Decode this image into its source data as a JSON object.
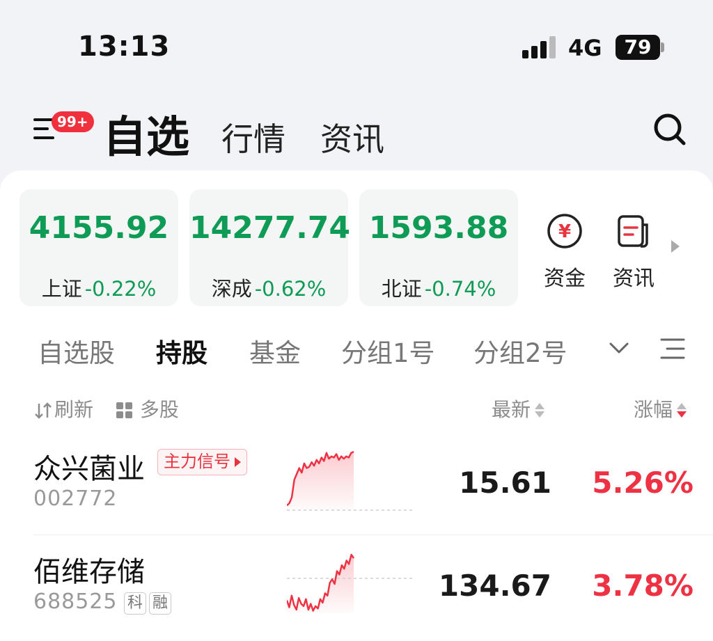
{
  "status_bar": {
    "time": "13:13",
    "network": "4G",
    "battery": "79"
  },
  "header": {
    "badge": "99+",
    "tabs": [
      {
        "label": "自选"
      },
      {
        "label": "行情"
      },
      {
        "label": "资讯"
      }
    ]
  },
  "indices": [
    {
      "value": "4155.92",
      "name": "上证",
      "change": "-0.22%"
    },
    {
      "value": "14277.74",
      "name": "深成",
      "change": "-0.62%"
    },
    {
      "value": "1593.88",
      "name": "北证",
      "change": "-0.74%"
    }
  ],
  "quick_links": [
    {
      "label": "资金",
      "icon": "yuan-circle-icon",
      "color": "#e8343f"
    },
    {
      "label": "资讯",
      "icon": "news-doc-icon",
      "color": "#e8343f"
    }
  ],
  "group_tabs": [
    {
      "label": "自选股"
    },
    {
      "label": "持股"
    },
    {
      "label": "基金"
    },
    {
      "label": "分组1号"
    },
    {
      "label": "分组2号"
    }
  ],
  "list_header": {
    "refresh": "刷新",
    "multi": "多股",
    "latest": "最新",
    "change": "涨幅"
  },
  "stocks": [
    {
      "name": "众兴菌业",
      "code": "002772",
      "tag": "主力信号",
      "price": "15.61",
      "change": "5.26%",
      "spark": [
        0.08,
        0.12,
        0.22,
        0.52,
        0.62,
        0.72,
        0.64,
        0.8,
        0.72,
        0.74,
        0.82,
        0.76,
        0.86,
        0.8,
        0.9,
        0.84,
        0.98,
        0.88,
        0.92,
        0.9,
        0.96,
        0.86,
        0.92,
        0.88,
        0.92,
        0.9,
        0.98,
        1.0
      ]
    },
    {
      "name": "佰维存储",
      "code": "688525",
      "badges": [
        "科",
        "融"
      ],
      "price": "134.67",
      "change": "3.78%",
      "spark": [
        0.22,
        0.1,
        0.3,
        0.14,
        0.06,
        0.26,
        0.16,
        0.12,
        0.24,
        0.06,
        0.16,
        0.04,
        0.12,
        0.08,
        0.24,
        0.18,
        0.34,
        0.3,
        0.52,
        0.58,
        0.5,
        0.72,
        0.66,
        0.82,
        0.76,
        0.9,
        0.84,
        1.0,
        0.94
      ]
    }
  ],
  "colors": {
    "up": "#ee3243",
    "down": "#0e9b55"
  }
}
